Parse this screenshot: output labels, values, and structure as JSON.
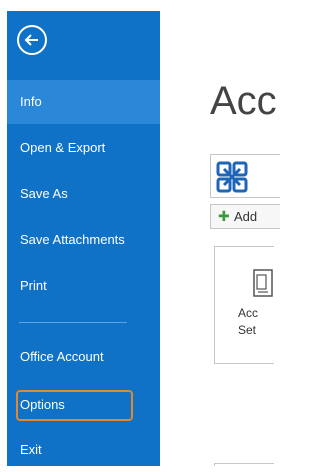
{
  "sidebar": {
    "back_icon": "back-arrow-icon",
    "items": [
      {
        "label": "Info",
        "active": true
      },
      {
        "label": "Open & Export"
      },
      {
        "label": "Save As"
      },
      {
        "label": "Save Attachments"
      },
      {
        "label": "Print"
      },
      {
        "label": "Office Account"
      },
      {
        "label": "Options",
        "highlighted": true
      },
      {
        "label": "Exit"
      }
    ]
  },
  "main": {
    "title": "Acc",
    "account_icon": "exchange-logo-icon",
    "add_account_label": "Add",
    "tile": {
      "icon": "account-settings-icon",
      "label_line1": "Acc",
      "label_line2": "Set"
    }
  },
  "colors": {
    "sidebar_bg": "#0f72c6",
    "active_item_bg": "#2b87d8",
    "highlight_border": "#e1892f",
    "plus_green": "#3b9a3b"
  }
}
